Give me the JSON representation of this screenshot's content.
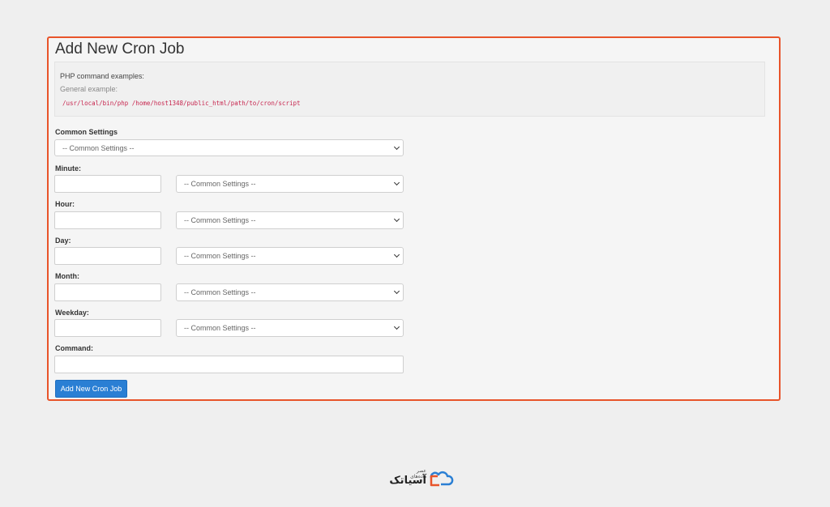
{
  "page": {
    "title": "Add New Cron Job"
  },
  "info": {
    "line1": "PHP command examples:",
    "line2": "General example:",
    "code": "/usr/local/bin/php /home/host1348/public_html/path/to/cron/script"
  },
  "form": {
    "common_settings_label": "Common Settings",
    "common_settings_value": "-- Common Settings --",
    "minute_label": "Minute:",
    "minute_value": "",
    "minute_select": "-- Common Settings --",
    "hour_label": "Hour:",
    "hour_value": "",
    "hour_select": "-- Common Settings --",
    "day_label": "Day:",
    "day_value": "",
    "day_select": "-- Common Settings --",
    "month_label": "Month:",
    "month_value": "",
    "month_select": "-- Common Settings --",
    "weekday_label": "Weekday:",
    "weekday_value": "",
    "weekday_select": "-- Common Settings --",
    "command_label": "Command:",
    "command_value": "",
    "submit_label": "Add New Cron Job"
  },
  "watermark": {
    "brand": "آسیاتک",
    "tagline": "عصر دادەهای"
  },
  "colors": {
    "highlight_border": "#e8542a",
    "button": "#2a7fd4",
    "code_text": "#c7254e",
    "logo_orange": "#e8542a",
    "logo_blue": "#2a7fd4"
  }
}
